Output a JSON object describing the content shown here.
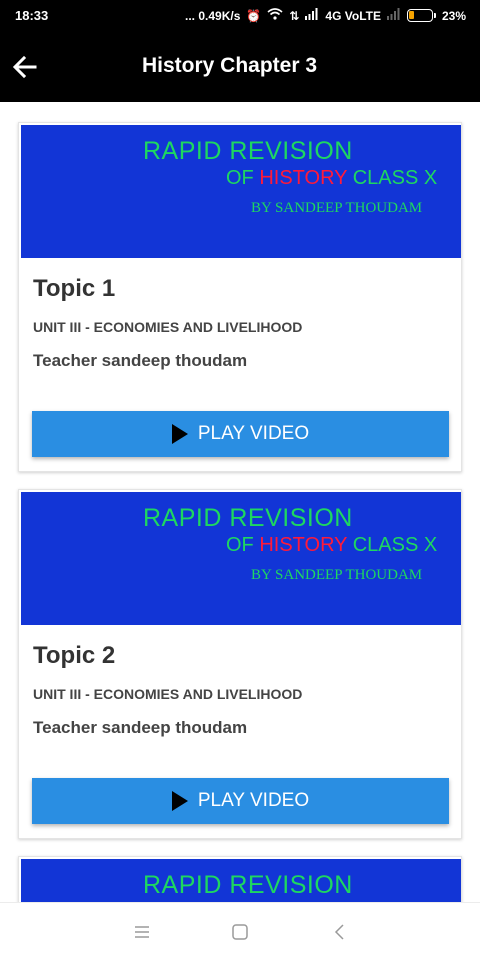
{
  "status_bar": {
    "time": "18:33",
    "net_speed": "... 0.49K/s",
    "network": "4G VoLTE",
    "battery": "23%"
  },
  "app_bar": {
    "title": "History Chapter 3",
    "back_icon": "arrow-left-icon"
  },
  "thumbnail": {
    "line1": "RAPID REVISION",
    "line2_prefix": "OF ",
    "line2_highlight": "HISTORY",
    "line2_suffix": " CLASS X",
    "line3": "BY SANDEEP THOUDAM",
    "bg_color": "#1235d6",
    "text_color": "#1ed760",
    "highlight_color": "#ff1a3a"
  },
  "cards": [
    {
      "topic": "Topic 1",
      "unit": "UNIT III - ECONOMIES AND LIVELIHOOD",
      "teacher": "Teacher sandeep thoudam",
      "play_label": "PLAY VIDEO"
    },
    {
      "topic": "Topic 2",
      "unit": "UNIT III - ECONOMIES AND LIVELIHOOD",
      "teacher": "Teacher sandeep thoudam",
      "play_label": "PLAY VIDEO"
    }
  ],
  "accent_color": "#2a8ee2",
  "nav_bar": {
    "menu_icon": "menu-icon",
    "home_icon": "square-home-icon",
    "back_icon": "chevron-back-icon"
  }
}
